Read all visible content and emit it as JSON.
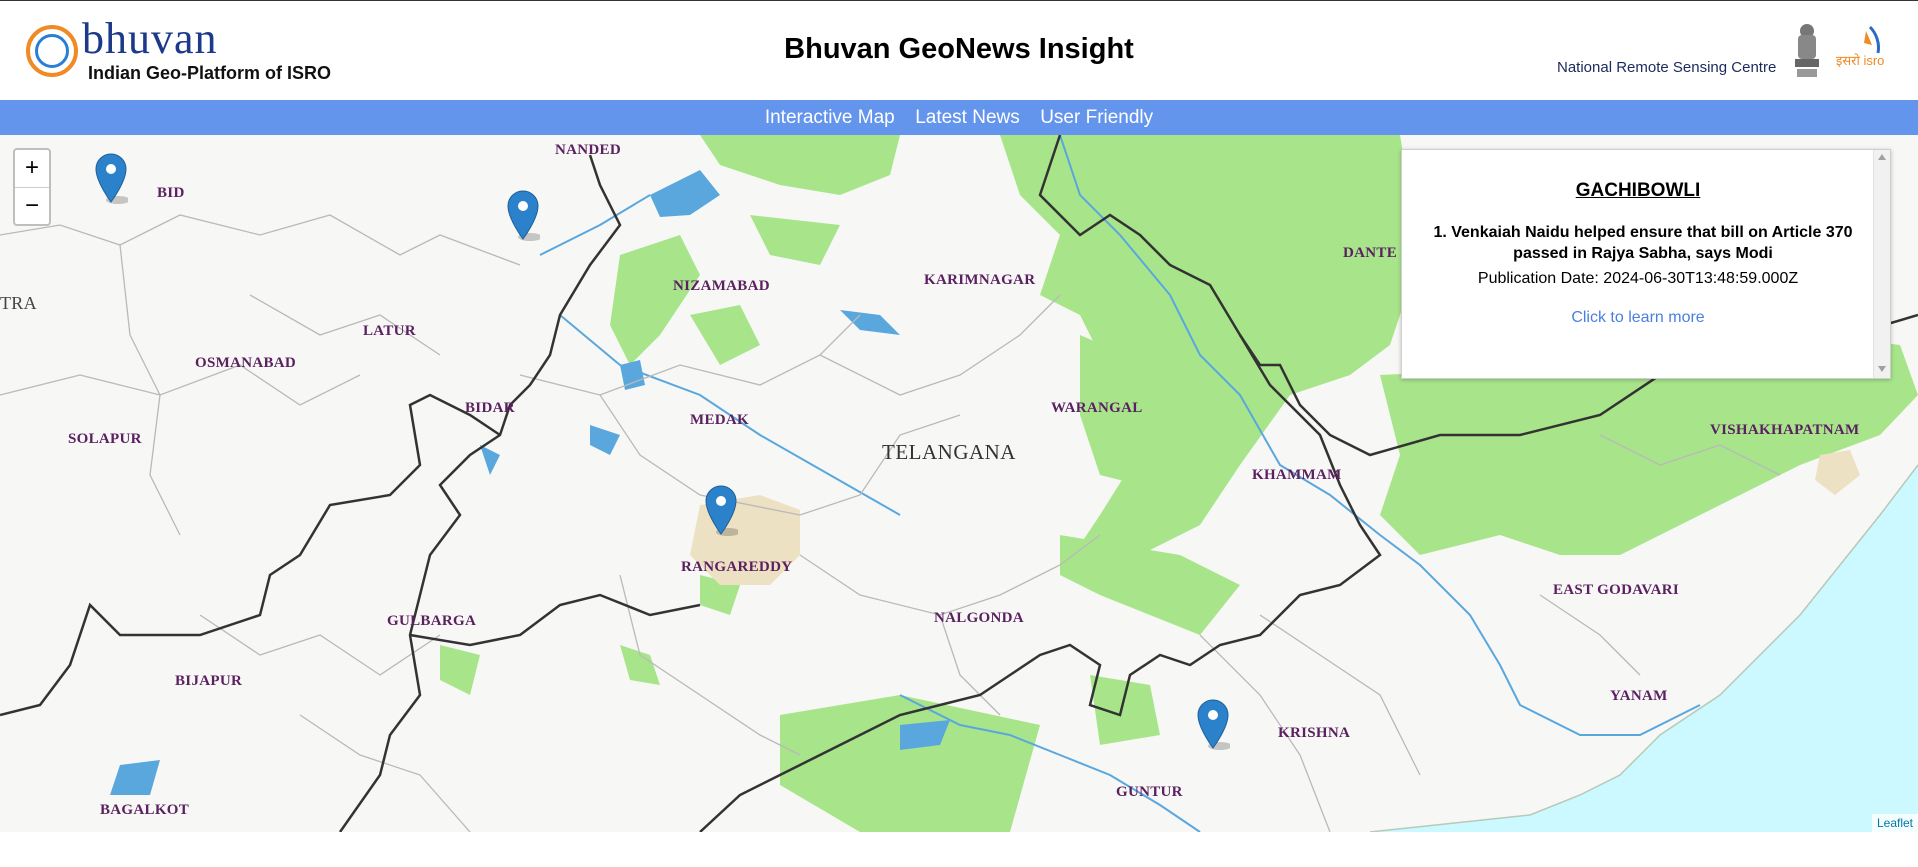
{
  "header": {
    "logo_word": "bhuvan",
    "logo_subtitle": "Indian Geo-Platform of ISRO",
    "title": "Bhuvan GeoNews Insight",
    "org_name": "National Remote Sensing Centre",
    "isro_logo_text": "इसरो isro"
  },
  "nav": {
    "items": [
      "Interactive Map",
      "Latest News",
      "User Friendly"
    ]
  },
  "map": {
    "zoom_in": "+",
    "zoom_out": "−",
    "state_label": "TELANGANA",
    "edge_label_left": "TRA",
    "places": [
      "NANDED",
      "BID",
      "NIZAMABAD",
      "KARIMNAGAR",
      "DANTE",
      "LATUR",
      "OSMANABAD",
      "BIDAR",
      "MEDAK",
      "WARANGAL",
      "VISHAKHAPATNAM",
      "SOLAPUR",
      "KHAMMAM",
      "RANGAREDDY",
      "EAST GODAVARI",
      "GULBARGA",
      "NALGONDA",
      "BIJAPUR",
      "YANAM",
      "KRISHNA",
      "GUNTUR",
      "BAGALKOT"
    ],
    "attribution": "Leaflet",
    "colors": {
      "vegetation": "#a8e58a",
      "water": "#5aa7de",
      "sea": "#ccf8ff",
      "urban": "#ede1c4",
      "marker": "#2b82cb"
    }
  },
  "popup": {
    "title": "GACHIBOWLI",
    "news": "1. Venkaiah Naidu helped ensure that bill on Article 370 passed in Rajya Sabha, says Modi",
    "date": "Publication Date: 2024-06-30T13:48:59.000Z",
    "link": "Click to learn more"
  }
}
